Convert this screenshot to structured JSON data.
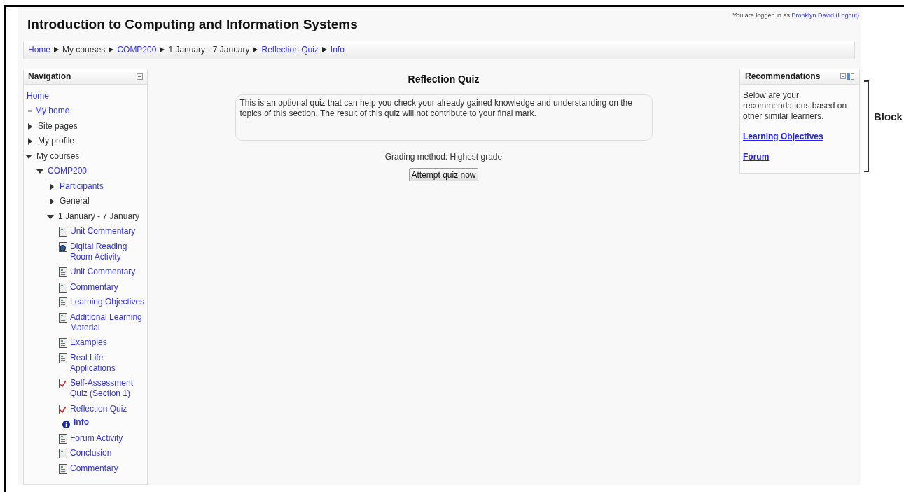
{
  "header": {
    "title": "Introduction to Computing and Information Systems",
    "login": {
      "prefix": "You are logged in as",
      "user": "Brooklyn David",
      "logout": "(Logout)"
    }
  },
  "breadcrumb": [
    {
      "label": "Home",
      "link": true
    },
    {
      "label": "My courses",
      "link": false
    },
    {
      "label": "COMP200",
      "link": true
    },
    {
      "label": "1 January - 7 January",
      "link": false
    },
    {
      "label": "Reflection Quiz",
      "link": true
    },
    {
      "label": "Info",
      "link": true
    }
  ],
  "navigation": {
    "title": "Navigation",
    "items": [
      {
        "label": "Home",
        "kind": "link",
        "active": false
      },
      {
        "label": "My home",
        "kind": "bullet",
        "active": false
      },
      {
        "label": "Site pages",
        "kind": "branch",
        "link": false,
        "expanded": false,
        "active": false
      },
      {
        "label": "My profile",
        "kind": "branch",
        "link": false,
        "expanded": false,
        "active": false
      },
      {
        "label": "My courses",
        "kind": "branch",
        "link": false,
        "expanded": true,
        "active": false,
        "children": [
          {
            "label": "COMP200",
            "kind": "branch",
            "link": true,
            "expanded": true,
            "active": false,
            "children": [
              {
                "label": "Participants",
                "kind": "branch",
                "link": true,
                "expanded": false,
                "active": false
              },
              {
                "label": "General",
                "kind": "branch",
                "link": false,
                "expanded": false,
                "active": false
              },
              {
                "label": "1 January - 7 January",
                "kind": "branch",
                "link": false,
                "expanded": true,
                "active": false,
                "children": [
                  {
                    "label": "Unit Commentary",
                    "kind": "page",
                    "active": false
                  },
                  {
                    "label": "Digital Reading Room Activity",
                    "kind": "url",
                    "active": false
                  },
                  {
                    "label": "Unit Commentary",
                    "kind": "page",
                    "active": false
                  },
                  {
                    "label": "Commentary",
                    "kind": "page",
                    "active": false
                  },
                  {
                    "label": "Learning Objectives",
                    "kind": "page",
                    "active": false
                  },
                  {
                    "label": "Additional Learning Material",
                    "kind": "page",
                    "active": false
                  },
                  {
                    "label": "Examples",
                    "kind": "page",
                    "active": false
                  },
                  {
                    "label": "Real Life Applications",
                    "kind": "page",
                    "active": false
                  },
                  {
                    "label": "Self-Assessment Quiz (Section 1)",
                    "kind": "quiz",
                    "active": false
                  },
                  {
                    "label": "Reflection Quiz",
                    "kind": "quiz",
                    "active": false,
                    "children": [
                      {
                        "label": "Info",
                        "kind": "info",
                        "active": true
                      }
                    ]
                  },
                  {
                    "label": "Forum Activity",
                    "kind": "page",
                    "active": false
                  },
                  {
                    "label": "Conclusion",
                    "kind": "page",
                    "active": false
                  },
                  {
                    "label": "Commentary",
                    "kind": "page",
                    "active": false
                  }
                ]
              }
            ]
          }
        ]
      }
    ]
  },
  "main": {
    "title": "Reflection Quiz",
    "intro": "This is an optional quiz that can help you check your already gained knowledge and understanding on the topics of this section. The result of this quiz will not contribute to your final mark.",
    "grading": "Grading method: Highest grade",
    "button": "Attempt quiz now"
  },
  "recommendations": {
    "title": "Recommendations",
    "text": "Below are your recommendations based on other similar learners.",
    "links": [
      "Learning Objectives",
      "Forum"
    ]
  },
  "annotation": {
    "label": "Block"
  }
}
